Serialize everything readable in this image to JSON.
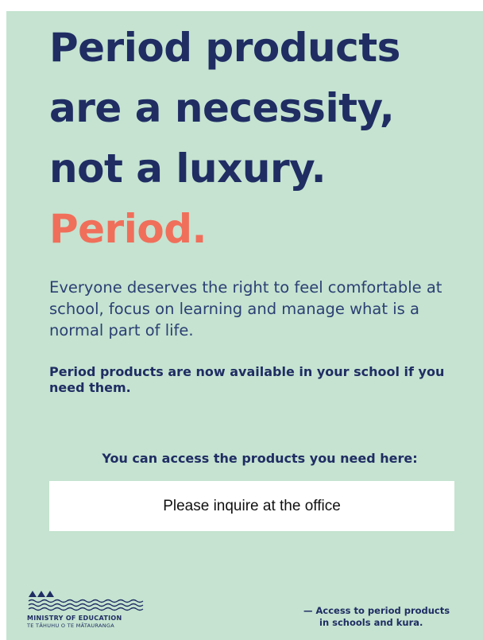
{
  "headline": {
    "line1": "Period products",
    "line2": "are a necessity,",
    "line3": "not a luxury.",
    "accent": "Period."
  },
  "body": "Everyone deserves the right to feel comfortable at school, focus on learning and manage what is a normal part of life.",
  "note": "Period products are now available in your school if you need them.",
  "access_label": "You can access the products you need here:",
  "access_location": "Please inquire at the office",
  "logo": {
    "title": "MINISTRY OF EDUCATION",
    "subtitle": "TE TĀHUHU O TE MĀTAURANGA"
  },
  "tagline": {
    "line1": "— Access to period products",
    "line2": "in schools and kura."
  },
  "colors": {
    "background": "#c5e3d0",
    "navy": "#1f2d63",
    "accent": "#f06f5b"
  }
}
